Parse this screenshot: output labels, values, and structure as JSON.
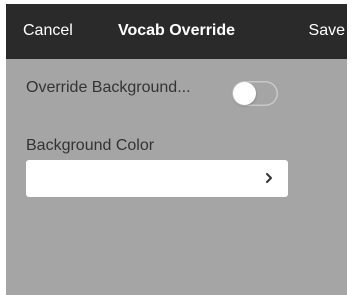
{
  "nav": {
    "cancel_label": "Cancel",
    "title": "Vocab Override",
    "save_label": "Save"
  },
  "form": {
    "override_background_label": "Override Background...",
    "override_background_on": false,
    "background_color_label": "Background Color",
    "background_color_value": ""
  },
  "icons": {
    "field_disclosure": "chevron-right-icon"
  },
  "colors": {
    "nav_bar": "#2a2a2a",
    "nav_text": "#ffffff",
    "content_background": "#a5a5a5",
    "field_background": "#ffffff",
    "label_text": "#333333"
  }
}
